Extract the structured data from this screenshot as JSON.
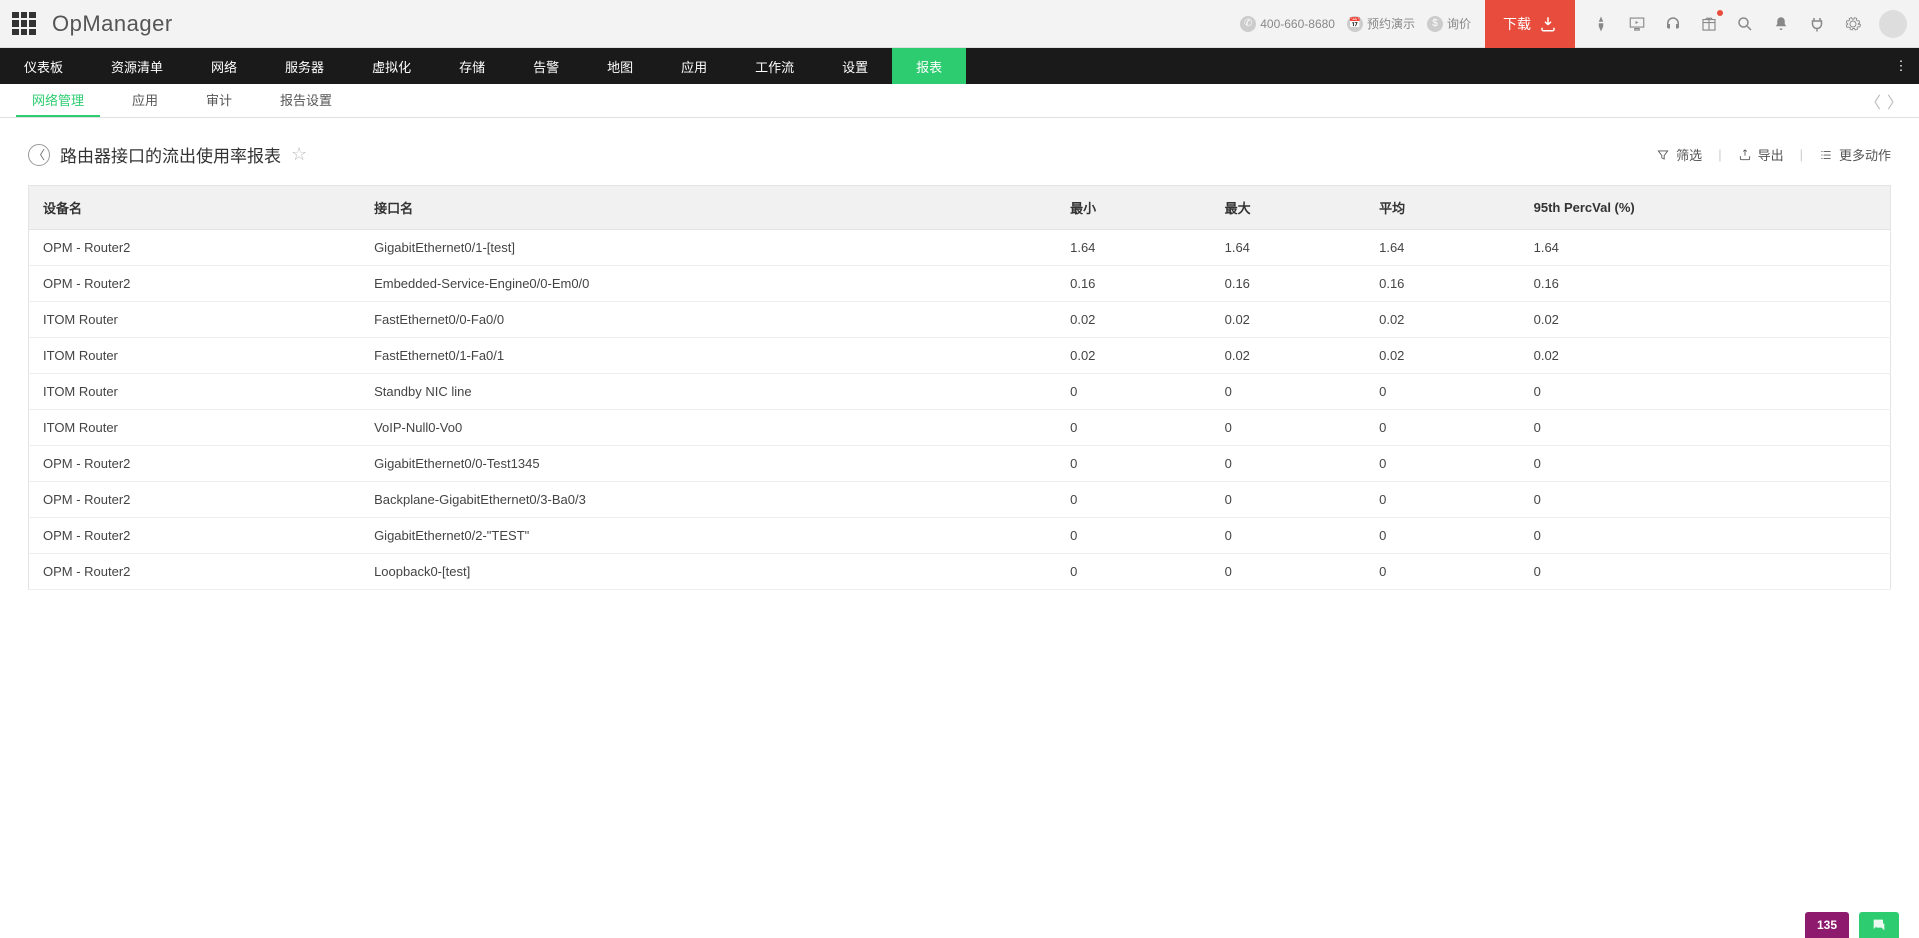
{
  "header": {
    "brand": "OpManager",
    "phone": "400-660-8680",
    "demo": "预约演示",
    "quote": "询价",
    "download": "下载"
  },
  "main_nav": {
    "items": [
      "仪表板",
      "资源清单",
      "网络",
      "服务器",
      "虚拟化",
      "存储",
      "告警",
      "地图",
      "应用",
      "工作流",
      "设置",
      "报表"
    ],
    "active_index": 11
  },
  "sub_nav": {
    "items": [
      "网络管理",
      "应用",
      "审计",
      "报告设置"
    ],
    "active_index": 0
  },
  "page": {
    "title": "路由器接口的流出使用率报表",
    "filter": "筛选",
    "export": "导出",
    "more": "更多动作"
  },
  "table": {
    "headers": [
      "设备名",
      "接口名",
      "最小",
      "最大",
      "平均",
      "95th PercVal (%)"
    ],
    "rows": [
      [
        "OPM - Router2",
        "GigabitEthernet0/1-[test]",
        "1.64",
        "1.64",
        "1.64",
        "1.64"
      ],
      [
        "OPM - Router2",
        "Embedded-Service-Engine0/0-Em0/0",
        "0.16",
        "0.16",
        "0.16",
        "0.16"
      ],
      [
        "ITOM Router",
        "FastEthernet0/0-Fa0/0",
        "0.02",
        "0.02",
        "0.02",
        "0.02"
      ],
      [
        "ITOM Router",
        "FastEthernet0/1-Fa0/1",
        "0.02",
        "0.02",
        "0.02",
        "0.02"
      ],
      [
        "ITOM Router",
        "Standby NIC line",
        "0",
        "0",
        "0",
        "0"
      ],
      [
        "ITOM Router",
        "VoIP-Null0-Vo0",
        "0",
        "0",
        "0",
        "0"
      ],
      [
        "OPM - Router2",
        "GigabitEthernet0/0-Test1345",
        "0",
        "0",
        "0",
        "0"
      ],
      [
        "OPM - Router2",
        "Backplane-GigabitEthernet0/3-Ba0/3",
        "0",
        "0",
        "0",
        "0"
      ],
      [
        "OPM - Router2",
        "GigabitEthernet0/2-\"TEST\"",
        "0",
        "0",
        "0",
        "0"
      ],
      [
        "OPM - Router2",
        "Loopback0-[test]",
        "0",
        "0",
        "0",
        "0"
      ]
    ]
  },
  "bottom": {
    "count": "135"
  }
}
